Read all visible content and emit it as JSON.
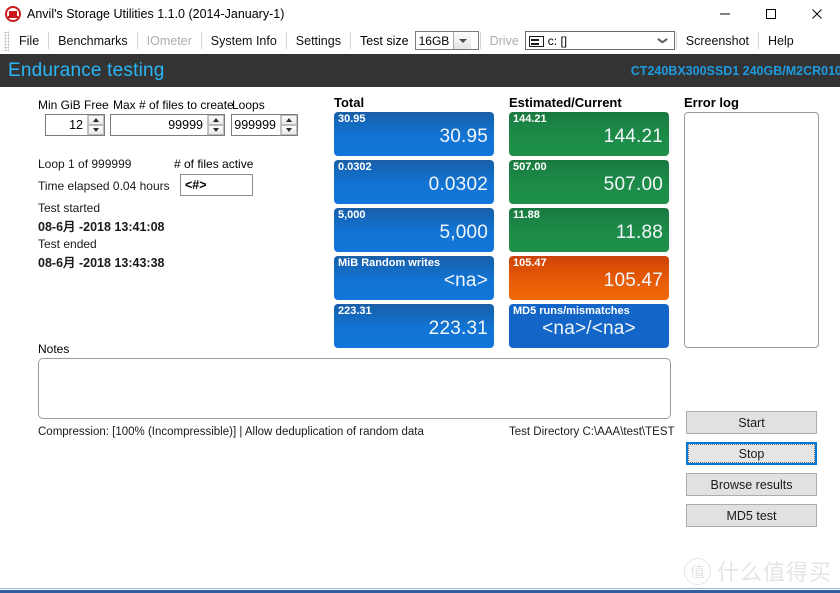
{
  "window": {
    "title": "Anvil's Storage Utilities 1.1.0 (2014-January-1)",
    "icon": "anvil-icon",
    "minimize_label": "–",
    "maximize_label": "□",
    "close_label": "✕"
  },
  "menubar": {
    "items": [
      {
        "label": "File",
        "disabled": false
      },
      {
        "label": "Benchmarks",
        "disabled": false
      },
      {
        "label": "IOmeter",
        "disabled": true
      },
      {
        "label": "System Info",
        "disabled": false
      },
      {
        "label": "Settings",
        "disabled": false
      }
    ],
    "test_size_label": "Test size",
    "test_size_value": "16GB",
    "drive_label": "Drive",
    "drive_value": "c: []",
    "screenshot_label": "Screenshot",
    "help_label": "Help"
  },
  "banner": {
    "title": "Endurance testing",
    "device": "CT240BX300SSD1 240GB/M2CR010",
    "title_color": "#29b6f6",
    "device_color": "#1e9be0",
    "background": "#333333"
  },
  "params": {
    "min_gib_free_label": "Min GiB Free",
    "min_gib_free_value": "12",
    "max_files_label": "Max # of files to create",
    "max_files_value": "99999",
    "loops_label": "Loops",
    "loops_value": "999999"
  },
  "status": {
    "loop_line": "Loop  1 of 999999",
    "time_elapsed_line": "Time elapsed 0.04 hours",
    "test_started_label": "Test started",
    "test_started_value": "08-6月 -2018 13:41:08",
    "test_ended_label": "Test ended",
    "test_ended_value": "08-6月 -2018 13:43:38",
    "files_active_label": "# of files active",
    "files_active_value": "<#>"
  },
  "columns": {
    "total_header": "Total",
    "estimated_header": "Estimated/Current",
    "errorlog_header": "Error log"
  },
  "total_tiles": [
    {
      "caption": "30.95",
      "value": "30.95",
      "color": "blue"
    },
    {
      "caption": "0.0302",
      "value": "0.0302",
      "color": "blue"
    },
    {
      "caption": "5,000",
      "value": "5,000",
      "color": "blue"
    },
    {
      "caption": "MiB Random writes",
      "value": "<na>",
      "color": "blue"
    },
    {
      "caption": "223.31",
      "value": "223.31",
      "color": "blue"
    }
  ],
  "estimated_tiles": [
    {
      "caption": "144.21",
      "value": "144.21",
      "color": "green"
    },
    {
      "caption": "507.00",
      "value": "507.00",
      "color": "green"
    },
    {
      "caption": "11.88",
      "value": "11.88",
      "color": "green"
    },
    {
      "caption": "105.47",
      "value": "105.47",
      "color": "orange"
    },
    {
      "caption": "MD5 runs/mismatches",
      "value": "<na>/<na>",
      "color": "flatblue"
    }
  ],
  "errorlog": {
    "content": ""
  },
  "notes": {
    "label": "Notes",
    "value": ""
  },
  "buttons": {
    "start": "Start",
    "stop": "Stop",
    "browse_results": "Browse results",
    "md5_test": "MD5 test"
  },
  "footer": {
    "compression": "Compression: [100% (Incompressible)] | Allow deduplication of random data",
    "test_directory": "Test Directory C:\\AAA\\test\\TEST"
  },
  "watermark": {
    "mark": "值",
    "text": "什么值得买"
  },
  "colors": {
    "accent_blue": "#0078d7",
    "tile_blue": "#1274d4",
    "tile_green": "#1d8d49",
    "tile_orange": "#e85d07",
    "banner_bg": "#333333"
  }
}
